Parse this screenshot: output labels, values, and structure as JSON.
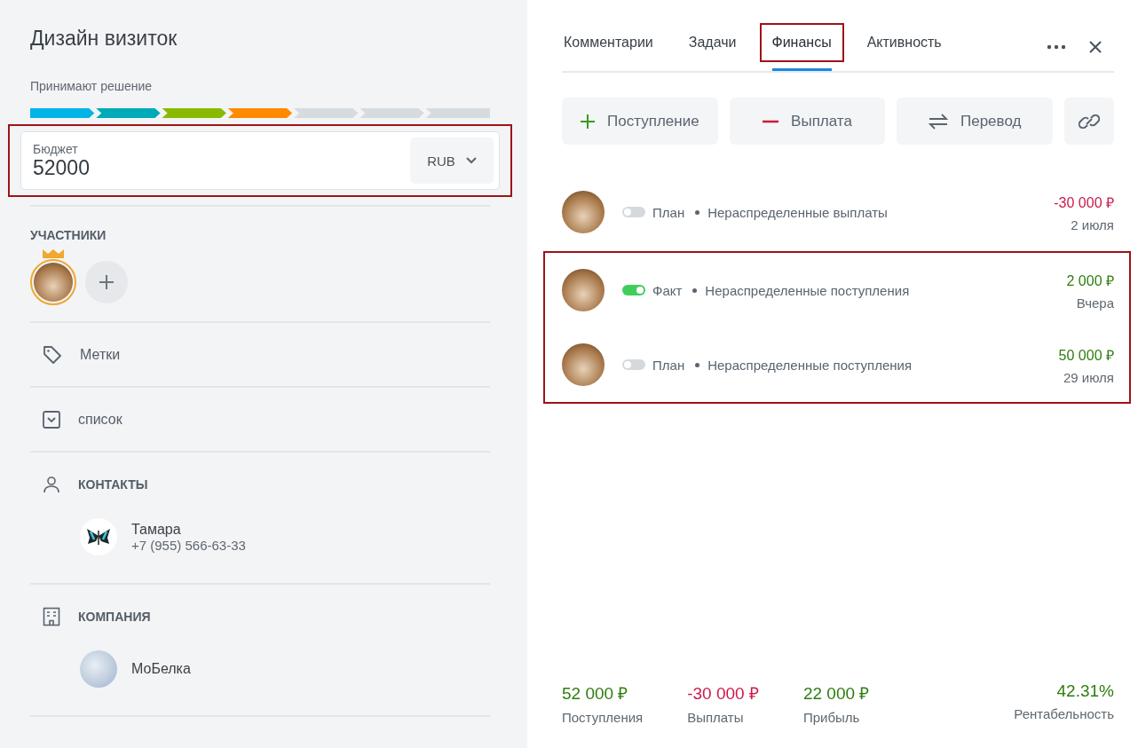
{
  "deal": {
    "title": "Дизайн визиток",
    "stage_label": "Принимают решение",
    "stages": [
      {
        "color": "#00b4e6"
      },
      {
        "color": "#00aab8"
      },
      {
        "color": "#88bb00"
      },
      {
        "color": "#ff8a00"
      },
      {
        "color": "#d6dbe0"
      },
      {
        "color": "#d6dbe0"
      },
      {
        "color": "#d6dbe0"
      }
    ],
    "budget": {
      "label": "Бюджет",
      "value": "52000",
      "currency": "RUB",
      "highlighted": true
    },
    "participants_title": "УЧАСТНИКИ",
    "tags_label": "Метки",
    "list_label": "список",
    "contacts": {
      "title": "КОНТАКТЫ",
      "items": [
        {
          "name": "Тамара",
          "phone": "+7 (955) 566-63-33"
        }
      ]
    },
    "company": {
      "title": "КОМПАНИЯ",
      "name": "МоБелка"
    }
  },
  "tabs": [
    {
      "label": "Комментарии",
      "selected": false,
      "highlighted": false
    },
    {
      "label": "Задачи",
      "selected": false,
      "highlighted": false
    },
    {
      "label": "Финансы",
      "selected": true,
      "highlighted": true
    },
    {
      "label": "Активность",
      "selected": false,
      "highlighted": false
    }
  ],
  "actions": [
    {
      "kind": "plus",
      "label": "Поступление"
    },
    {
      "kind": "minus",
      "label": "Выплата"
    },
    {
      "kind": "transfer",
      "label": "Перевод"
    },
    {
      "kind": "link"
    }
  ],
  "operation_groups": [
    {
      "highlighted": false,
      "items": [
        {
          "on": false,
          "status": "План",
          "category": "Нераспределенные выплаты",
          "amount": "-30 000 ₽",
          "kind": "expense",
          "date": "2 июля"
        }
      ]
    },
    {
      "highlighted": true,
      "items": [
        {
          "on": true,
          "status": "Факт",
          "category": "Нераспределенные поступления",
          "amount": "2 000 ₽",
          "kind": "income",
          "date": "Вчера"
        },
        {
          "on": false,
          "status": "План",
          "category": "Нераспределенные поступления",
          "amount": "50 000 ₽",
          "kind": "income",
          "date": "29 июля"
        }
      ]
    }
  ],
  "summary": [
    {
      "value": "52 000 ₽",
      "label": "Поступления",
      "kind": "income"
    },
    {
      "value": "-30 000 ₽",
      "label": "Выплаты",
      "kind": "expense"
    },
    {
      "value": "22 000 ₽",
      "label": "Прибыль",
      "kind": "income"
    },
    {
      "value": "42.31%",
      "label": "Рентабельность",
      "kind": "income"
    }
  ]
}
